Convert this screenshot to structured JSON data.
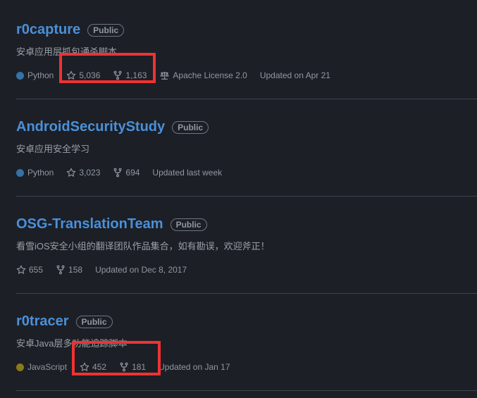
{
  "repos": [
    {
      "name": "r0capture",
      "visibility": "Public",
      "description": "安卓应用层抓包通杀脚本",
      "language": "Python",
      "language_color": "#3572A5",
      "stars": "5,036",
      "forks": "1,163",
      "license": "Apache License 2.0",
      "updated": "Updated on Apr 21"
    },
    {
      "name": "AndroidSecurityStudy",
      "visibility": "Public",
      "description": "安卓应用安全学习",
      "language": "Python",
      "language_color": "#3572A5",
      "stars": "3,023",
      "forks": "694",
      "updated": "Updated last week"
    },
    {
      "name": "OSG-TranslationTeam",
      "visibility": "Public",
      "description": "看雪iOS安全小组的翻译团队作品集合，如有勘误，欢迎斧正！",
      "stars": "655",
      "forks": "158",
      "updated": "Updated on Dec 8, 2017"
    },
    {
      "name": "r0tracer",
      "visibility": "Public",
      "description": "安卓Java层多功能追踪脚本",
      "language": "JavaScript",
      "language_color": "#8a7a1a",
      "stars": "452",
      "forks": "181",
      "updated": "Updated on Jan 17"
    }
  ],
  "highlight_color": "#f03232"
}
